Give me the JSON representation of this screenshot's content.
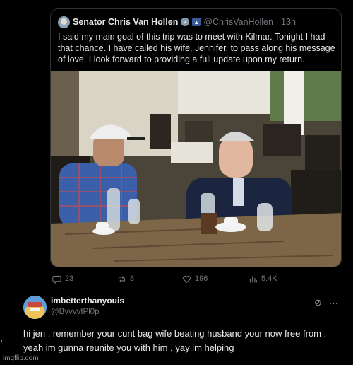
{
  "quoted_tweet": {
    "author_name": "Senator Chris Van Hollen",
    "handle_time": "@ChrisVanHollen · 13h",
    "text": "I said my main goal of this trip was to meet with Kilmar. Tonight I had that chance. I have called his wife, Jennifer, to pass along his message of love. I look forward to providing a full update upon my return."
  },
  "actions": {
    "replies": "23",
    "reposts": "8",
    "likes": "196",
    "views": "5.4K"
  },
  "reply": {
    "name": "imbetterthanyouis",
    "handle": "@BvvvvtPl0p",
    "text": "hi jen , remember your cunt bag wife beating husband your now free from , yeah im gunna reunite you with him , yay im helping"
  },
  "watermark": "imgflip.com",
  "icons": [
    "user-avatar",
    "verified-badge",
    "flag-badge",
    "reply-icon",
    "repost-icon",
    "like-icon",
    "views-icon",
    "grok-icon",
    "more-icon"
  ]
}
